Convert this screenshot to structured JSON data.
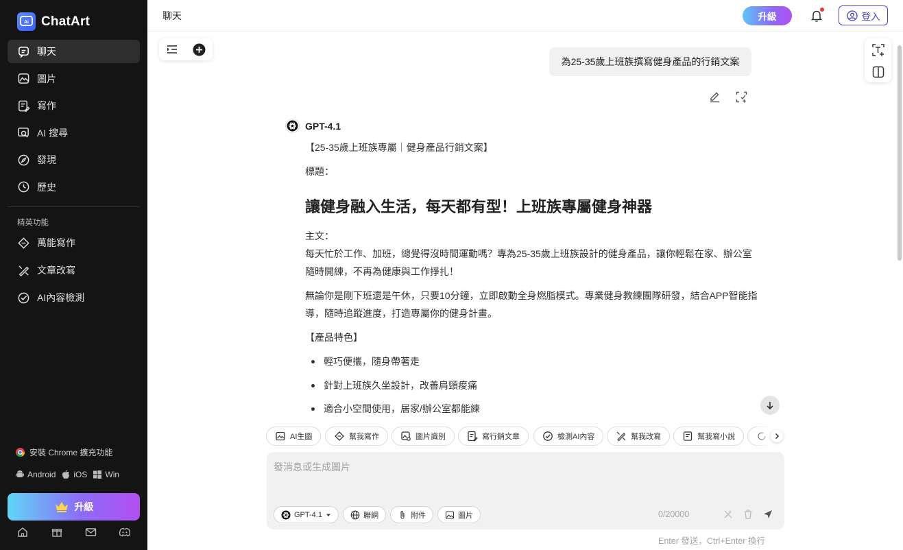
{
  "app": {
    "name": "ChatArt"
  },
  "sidebar": {
    "nav": [
      {
        "label": "聊天",
        "icon": "chat-icon"
      },
      {
        "label": "圖片",
        "icon": "image-icon"
      },
      {
        "label": "寫作",
        "icon": "write-icon"
      },
      {
        "label": "AI 搜尋",
        "icon": "ai-search-icon"
      },
      {
        "label": "發現",
        "icon": "compass-icon"
      },
      {
        "label": "歷史",
        "icon": "history-icon"
      }
    ],
    "section_title": "精英功能",
    "features": [
      {
        "label": "萬能寫作",
        "icon": "pen-diamond-icon"
      },
      {
        "label": "文章改寫",
        "icon": "rewrite-icon"
      },
      {
        "label": "AI內容檢測",
        "icon": "check-circle-icon"
      }
    ],
    "extension": "安裝 Chrome 擴充功能",
    "platforms": [
      "Android",
      "iOS",
      "Win"
    ],
    "upgrade_label": "升級"
  },
  "header": {
    "title": "聊天",
    "upgrade_label": "升級",
    "login_label": "登入"
  },
  "chat": {
    "user_message": "為25-35歲上班族撰寫健身產品的行銷文案",
    "model_name": "GPT-4.1",
    "answer": {
      "intro": "【25-35歲上班族專屬｜健身產品行銷文案】",
      "title_label": "標題：",
      "headline": "讓健身融入生活，每天都有型！上班族專屬健身神器",
      "body_label": "主文：",
      "para1": "每天忙於工作、加班，總覺得沒時間運動嗎？專為25-35歲上班族設計的健身產品，讓你輕鬆在家、辦公室隨時開練，不再為健康與工作掙扎！",
      "para2": "無論你是剛下班還是午休，只要10分鐘，立即啟動全身燃脂模式。專業健身教練團隊研發，結合APP智能指導，隨時追蹤進度，打造專屬你的健身計畫。",
      "features_label": "【產品特色】",
      "bullets": [
        "輕巧便攜，隨身帶著走",
        "針對上班族久坐設計，改善肩頸痠痛",
        "適合小空間使用，居家/辦公室都能練"
      ]
    }
  },
  "quick_actions": [
    {
      "label": "AI生圖",
      "icon": "image-gen-icon"
    },
    {
      "label": "幫我寫作",
      "icon": "pen-diamond-icon"
    },
    {
      "label": "圖片識別",
      "icon": "image-scan-icon"
    },
    {
      "label": "寫行銷文章",
      "icon": "write-icon"
    },
    {
      "label": "檢測AI內容",
      "icon": "check-circle-icon"
    },
    {
      "label": "幫我改寫",
      "icon": "rewrite-icon"
    },
    {
      "label": "幫我寫小說",
      "icon": "book-icon"
    }
  ],
  "composer": {
    "placeholder": "發消息或生成圖片",
    "model_label": "GPT-4.1",
    "web_label": "聯網",
    "attach_label": "附件",
    "image_label": "圖片",
    "count": "0/20000",
    "hint": "Enter 發送，Ctrl+Enter 換行"
  },
  "colors": {
    "sidebar_bg": "#141414",
    "accent": "#4a40c8",
    "upgrade_gradient": [
      "#5fd6f6",
      "#8c6cf7",
      "#b24ff0"
    ]
  }
}
